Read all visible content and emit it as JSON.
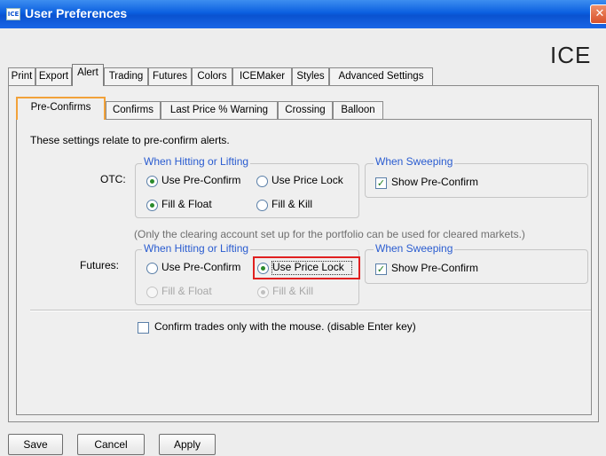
{
  "window": {
    "title": "User Preferences",
    "icon_text": "ICE",
    "close_glyph": "✕",
    "logo": "ICE"
  },
  "top_tabs": [
    {
      "label": "Print"
    },
    {
      "label": "Export"
    },
    {
      "label": "Alert",
      "active": true
    },
    {
      "label": "Trading"
    },
    {
      "label": "Futures"
    },
    {
      "label": "Colors"
    },
    {
      "label": "ICEMaker"
    },
    {
      "label": "Styles"
    },
    {
      "label": "Advanced Settings"
    }
  ],
  "sub_tabs": [
    {
      "label": "Pre-Confirms",
      "active": true
    },
    {
      "label": "Confirms"
    },
    {
      "label": "Last Price % Warning"
    },
    {
      "label": "Crossing"
    },
    {
      "label": "Balloon"
    }
  ],
  "intro_text": "These settings relate to pre-confirm alerts.",
  "otc": {
    "label": "OTC:",
    "hitting_title": "When Hitting or Lifting",
    "use_pre_confirm": "Use Pre-Confirm",
    "use_price_lock": "Use Price Lock",
    "fill_float": "Fill & Float",
    "fill_kill": "Fill & Kill",
    "sweeping_title": "When Sweeping",
    "show_pre_confirm": "Show Pre-Confirm",
    "selected_mode": "Use Pre-Confirm",
    "selected_fill": "Fill & Float",
    "show_pre_confirm_checked": true
  },
  "clearing_note": "(Only the clearing account set up for the portfolio can be used for cleared markets.)",
  "futures": {
    "label": "Futures:",
    "hitting_title": "When Hitting or Lifting",
    "use_pre_confirm": "Use Pre-Confirm",
    "use_price_lock": "Use Price Lock",
    "fill_float": "Fill & Float",
    "fill_kill": "Fill & Kill",
    "sweeping_title": "When Sweeping",
    "show_pre_confirm": "Show Pre-Confirm",
    "selected_mode": "Use Price Lock",
    "selected_fill": "Fill & Kill",
    "show_pre_confirm_checked": true
  },
  "mouse_confirm": {
    "label": "Confirm trades only with the mouse. (disable Enter key)",
    "checked": false
  },
  "buttons": {
    "save": "Save",
    "cancel": "Cancel",
    "apply": "Apply"
  },
  "colors": {
    "highlight": "#e02020",
    "active_tab_border": "#f2a23a",
    "group_title": "#2a5cd0"
  }
}
